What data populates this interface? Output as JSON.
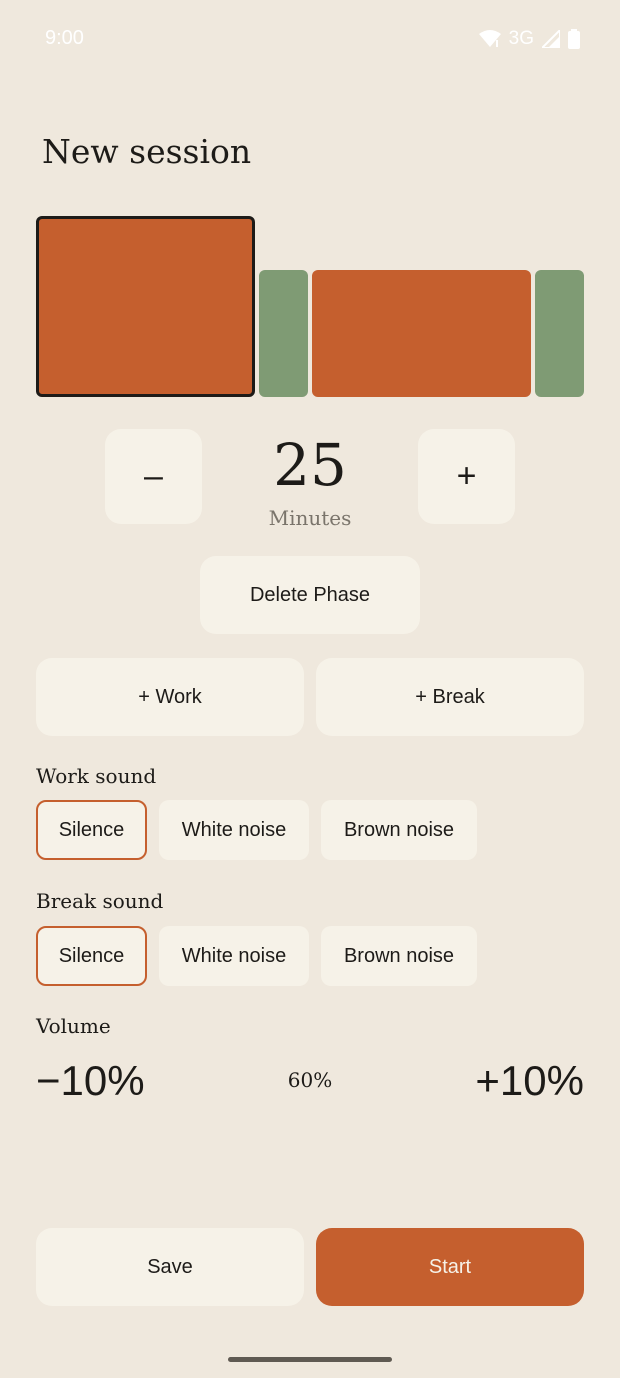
{
  "status_bar": {
    "time": "9:00",
    "network": "3G"
  },
  "title": "New session",
  "phases": [
    {
      "kind": "work",
      "color": "#C55F2E",
      "selected": true
    },
    {
      "kind": "break",
      "color": "#7F9B74",
      "selected": false
    },
    {
      "kind": "work",
      "color": "#C55F2E",
      "selected": false
    },
    {
      "kind": "break",
      "color": "#7F9B74",
      "selected": false
    }
  ],
  "duration": {
    "decrement_label": "–",
    "increment_label": "+",
    "value": "25",
    "unit": "Minutes"
  },
  "actions": {
    "delete_phase": "Delete Phase",
    "add_work": "+ Work",
    "add_break": "+ Break"
  },
  "work_sound": {
    "label": "Work sound",
    "options": [
      "Silence",
      "White noise",
      "Brown noise"
    ],
    "selected": "Silence"
  },
  "break_sound": {
    "label": "Break sound",
    "options": [
      "Silence",
      "White noise",
      "Brown noise"
    ],
    "selected": "Silence"
  },
  "volume": {
    "label": "Volume",
    "decrease_label": "−10%",
    "value": "60%",
    "increase_label": "+10%"
  },
  "footer": {
    "save_label": "Save",
    "start_label": "Start"
  },
  "colors": {
    "background": "#EFE8DD",
    "accent": "#C55F2E",
    "break_green": "#7F9B74",
    "button_bg": "#F6F2E8"
  }
}
